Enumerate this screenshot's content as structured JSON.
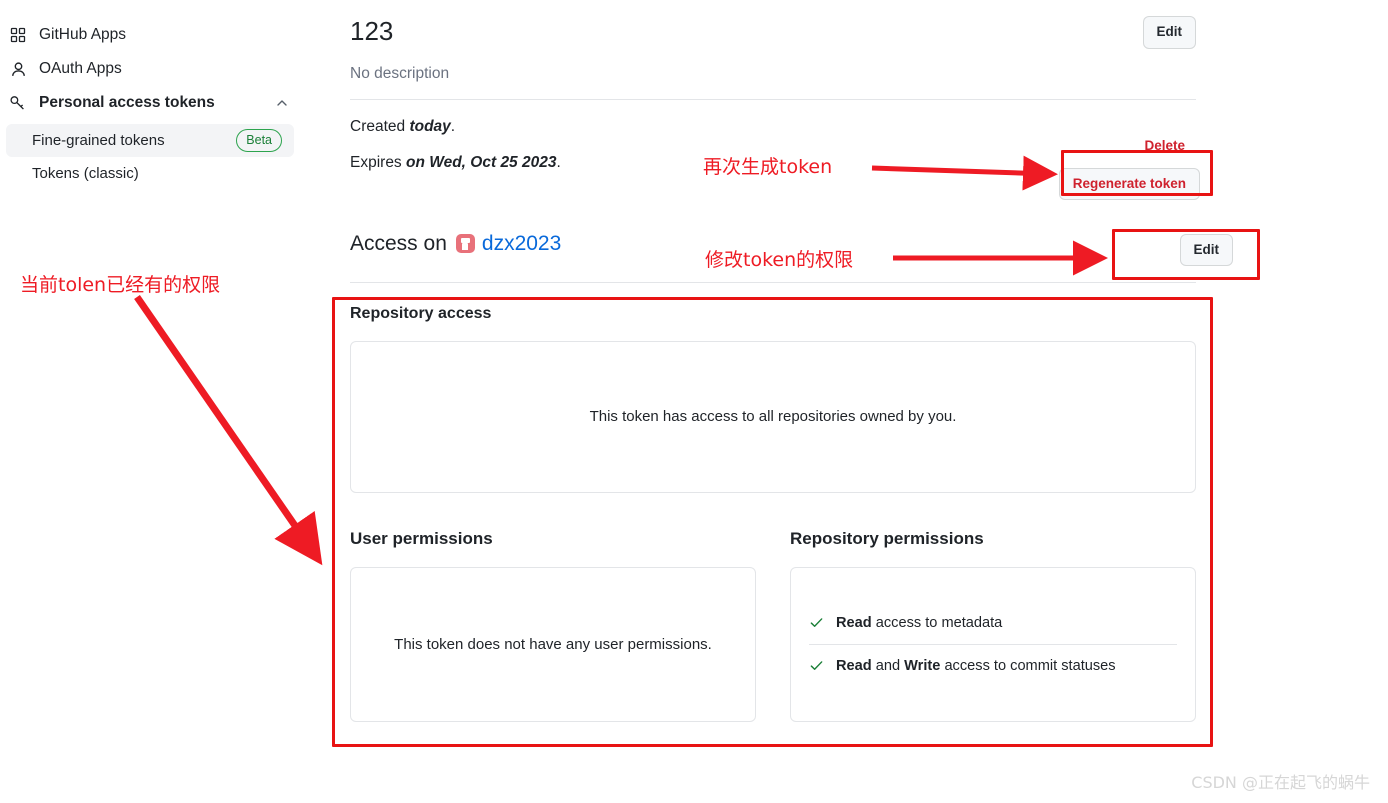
{
  "sidebar": {
    "items": [
      {
        "icon": "apps-grid-icon",
        "label": "GitHub Apps"
      },
      {
        "icon": "person-icon",
        "label": "OAuth Apps"
      },
      {
        "icon": "key-icon",
        "label": "Personal access tokens"
      }
    ],
    "subitems": [
      {
        "label": "Fine-grained tokens",
        "badge": "Beta"
      },
      {
        "label": "Tokens (classic)",
        "badge": ""
      }
    ]
  },
  "token": {
    "name": "123",
    "description": "No description",
    "edit_label": "Edit",
    "delete_label": "Delete",
    "regenerate_label": "Regenerate token",
    "created_prefix": "Created ",
    "created_value": "today",
    "created_suffix": ".",
    "expires_prefix": "Expires ",
    "expires_value": "on Wed, Oct 25 2023",
    "expires_suffix": "."
  },
  "access": {
    "heading": "Access on",
    "owner": "dzx2023",
    "edit_label": "Edit"
  },
  "repository_access": {
    "heading": "Repository access",
    "message": "This token has access to all repositories owned by you."
  },
  "user_permissions": {
    "heading": "User permissions",
    "message": "This token does not have any user permissions."
  },
  "repository_permissions": {
    "heading": "Repository permissions",
    "items": [
      {
        "level": "Read",
        "connector": "",
        "level2": "",
        "text": " access to metadata"
      },
      {
        "level": "Read",
        "connector": " and ",
        "level2": "Write",
        "text": " access to commit statuses"
      }
    ]
  },
  "annotations": {
    "regenerate_note": "再次生成token",
    "edit_permissions_note": "修改token的权限",
    "current_permissions_note": "当前tolen已经有的权限"
  },
  "watermark": "CSDN @正在起飞的蜗牛",
  "colors": {
    "annotation_red": "#ee1b24",
    "link_blue": "#0969da",
    "success_green": "#1a7f37",
    "danger_red": "#cf222e"
  }
}
